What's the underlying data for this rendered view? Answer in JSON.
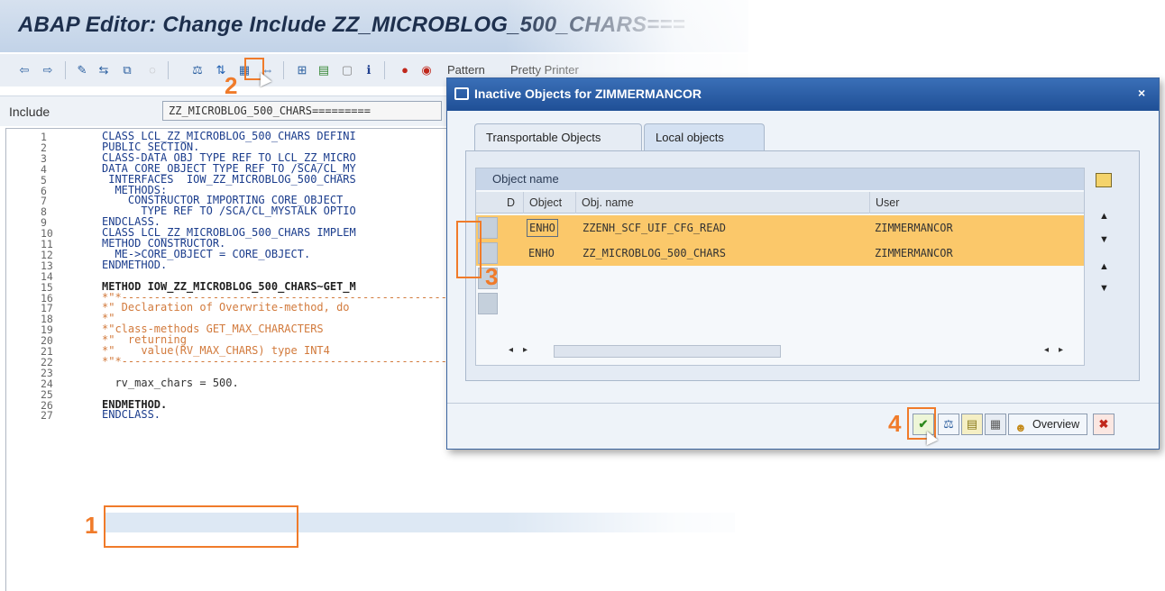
{
  "editor": {
    "title": "ABAP Editor: Change Include ZZ_MICROBLOG_500_CHARS===",
    "toolbar": {
      "pattern_label": "Pattern",
      "pretty_printer_label": "Pretty Printer"
    },
    "include_label": "Include",
    "include_value": "ZZ_MICROBLOG_500_CHARS=========",
    "code_lines": [
      {
        "n": "1",
        "text": "CLASS LCL_ZZ_MICROBLOG_500_CHARS DEFINI"
      },
      {
        "n": "2",
        "text": "PUBLIC SECTION."
      },
      {
        "n": "3",
        "text": "CLASS-DATA OBJ TYPE REF TO LCL_ZZ_MICRO"
      },
      {
        "n": "4",
        "text": "DATA CORE_OBJECT TYPE REF TO /SCA/CL_MY"
      },
      {
        "n": "5",
        "text": " INTERFACES  IOW_ZZ_MICROBLOG_500_CHARS"
      },
      {
        "n": "6",
        "text": "  METHODS:"
      },
      {
        "n": "7",
        "text": "    CONSTRUCTOR IMPORTING CORE_OBJECT"
      },
      {
        "n": "8",
        "text": "      TYPE REF TO /SCA/CL_MYSTALK OPTIO"
      },
      {
        "n": "9",
        "text": "ENDCLASS."
      },
      {
        "n": "10",
        "text": "CLASS LCL_ZZ_MICROBLOG_500_CHARS IMPLEM"
      },
      {
        "n": "11",
        "text": "METHOD CONSTRUCTOR."
      },
      {
        "n": "12",
        "text": "  ME->CORE_OBJECT = CORE_OBJECT."
      },
      {
        "n": "13",
        "text": "ENDMETHOD."
      },
      {
        "n": "14",
        "text": ""
      },
      {
        "n": "15",
        "text": "METHOD IOW_ZZ_MICROBLOG_500_CHARS~GET_M"
      },
      {
        "n": "16",
        "text": "*\"*---------------------------------------------------------------------------"
      },
      {
        "n": "17",
        "text": "*\" Declaration of Overwrite-method, do"
      },
      {
        "n": "18",
        "text": "*\""
      },
      {
        "n": "19",
        "text": "*\"class-methods GET_MAX_CHARACTERS"
      },
      {
        "n": "20",
        "text": "*\"  returning"
      },
      {
        "n": "21",
        "text": "*\"    value(RV_MAX_CHARS) type INT4"
      },
      {
        "n": "22",
        "text": "*\"*---------------------------------------------------------------------------"
      },
      {
        "n": "23",
        "text": ""
      },
      {
        "n": "24",
        "text": "  rv_max_chars = 500."
      },
      {
        "n": "25",
        "text": ""
      },
      {
        "n": "26",
        "text": "ENDMETHOD."
      },
      {
        "n": "27",
        "text": "ENDCLASS."
      }
    ]
  },
  "annotations": {
    "n1": "1",
    "n2": "2",
    "n3": "3",
    "n4": "4"
  },
  "dialog": {
    "title": "Inactive Objects for ZIMMERMANCOR",
    "close_glyph": "×",
    "tabs": [
      {
        "label": "Transportable Objects"
      },
      {
        "label": "Local objects"
      }
    ],
    "table": {
      "title": "Object name",
      "columns": [
        "D",
        "Object",
        "Obj. name",
        "User"
      ],
      "rows": [
        {
          "object": "ENHO",
          "obj_name": "ZZENH_SCF_UIF_CFG_READ",
          "user": "ZIMMERMANCOR"
        },
        {
          "object": "ENHO",
          "obj_name": "ZZ_MICROBLOG_500_CHARS",
          "user": "ZIMMERMANCOR"
        }
      ]
    },
    "buttons": {
      "overview": "Overview"
    }
  },
  "colors": {
    "accent": "#f07b2a",
    "row_highlight": "#fbc86a",
    "title_bar": "#1f4f96"
  }
}
